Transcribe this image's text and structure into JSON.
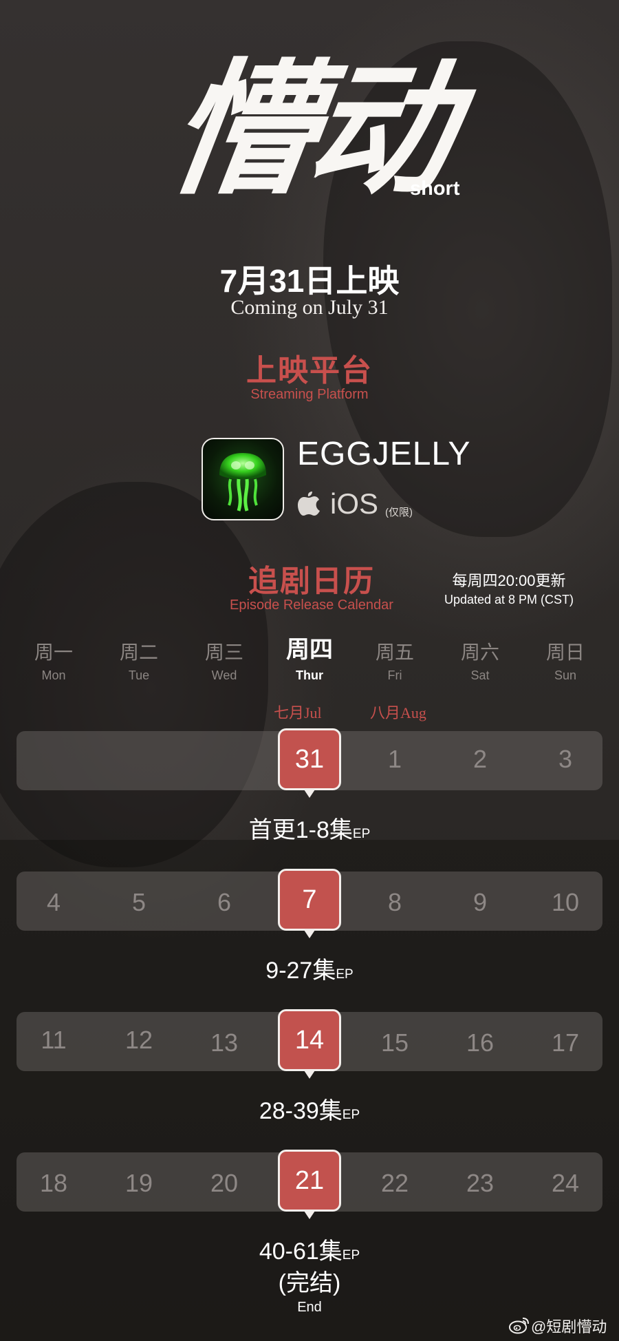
{
  "title": {
    "logo_cn": "懵动",
    "logo_tag": "short"
  },
  "release": {
    "date_cn": "7月31日上映",
    "date_en": "Coming on July 31"
  },
  "platform": {
    "heading_cn": "上映平台",
    "heading_en": "Streaming Platform",
    "app_name": "EGGJELLY",
    "os": "iOS",
    "os_note": "(仅限)"
  },
  "calendar": {
    "heading_cn": "追剧日历",
    "heading_en": "Episode Release Calendar",
    "update_cn": "每周四20:00更新",
    "update_en": "Updated at 8 PM (CST)",
    "weekdays": [
      {
        "cn": "周一",
        "en": "Mon"
      },
      {
        "cn": "周二",
        "en": "Tue"
      },
      {
        "cn": "周三",
        "en": "Wed"
      },
      {
        "cn": "周四",
        "en": "Thur"
      },
      {
        "cn": "周五",
        "en": "Fri"
      },
      {
        "cn": "周六",
        "en": "Sat"
      },
      {
        "cn": "周日",
        "en": "Sun"
      }
    ],
    "month_jul": "七月Jul",
    "month_aug": "八月Aug",
    "weeks": [
      {
        "days": [
          "",
          "",
          "",
          "31",
          "1",
          "2",
          "3"
        ],
        "episodes": "首更1-8集",
        "ep_suffix": "EP"
      },
      {
        "days": [
          "4",
          "5",
          "6",
          "7",
          "8",
          "9",
          "10"
        ],
        "episodes": "9-27集",
        "ep_suffix": "EP"
      },
      {
        "days": [
          "11",
          "12",
          "13",
          "14",
          "15",
          "16",
          "17"
        ],
        "episodes": "28-39集",
        "ep_suffix": "EP"
      },
      {
        "days": [
          "18",
          "19",
          "20",
          "21",
          "22",
          "23",
          "24"
        ],
        "episodes": "40-61集",
        "ep_suffix": "EP"
      }
    ],
    "finale_cn": "(完结)",
    "finale_en": "End"
  },
  "watermark": {
    "icon": "weibo-icon",
    "handle": "@短剧懵动"
  },
  "colors": {
    "accent": "#c8504d",
    "highlight": "#c2524e",
    "background": "#2f2b29"
  }
}
